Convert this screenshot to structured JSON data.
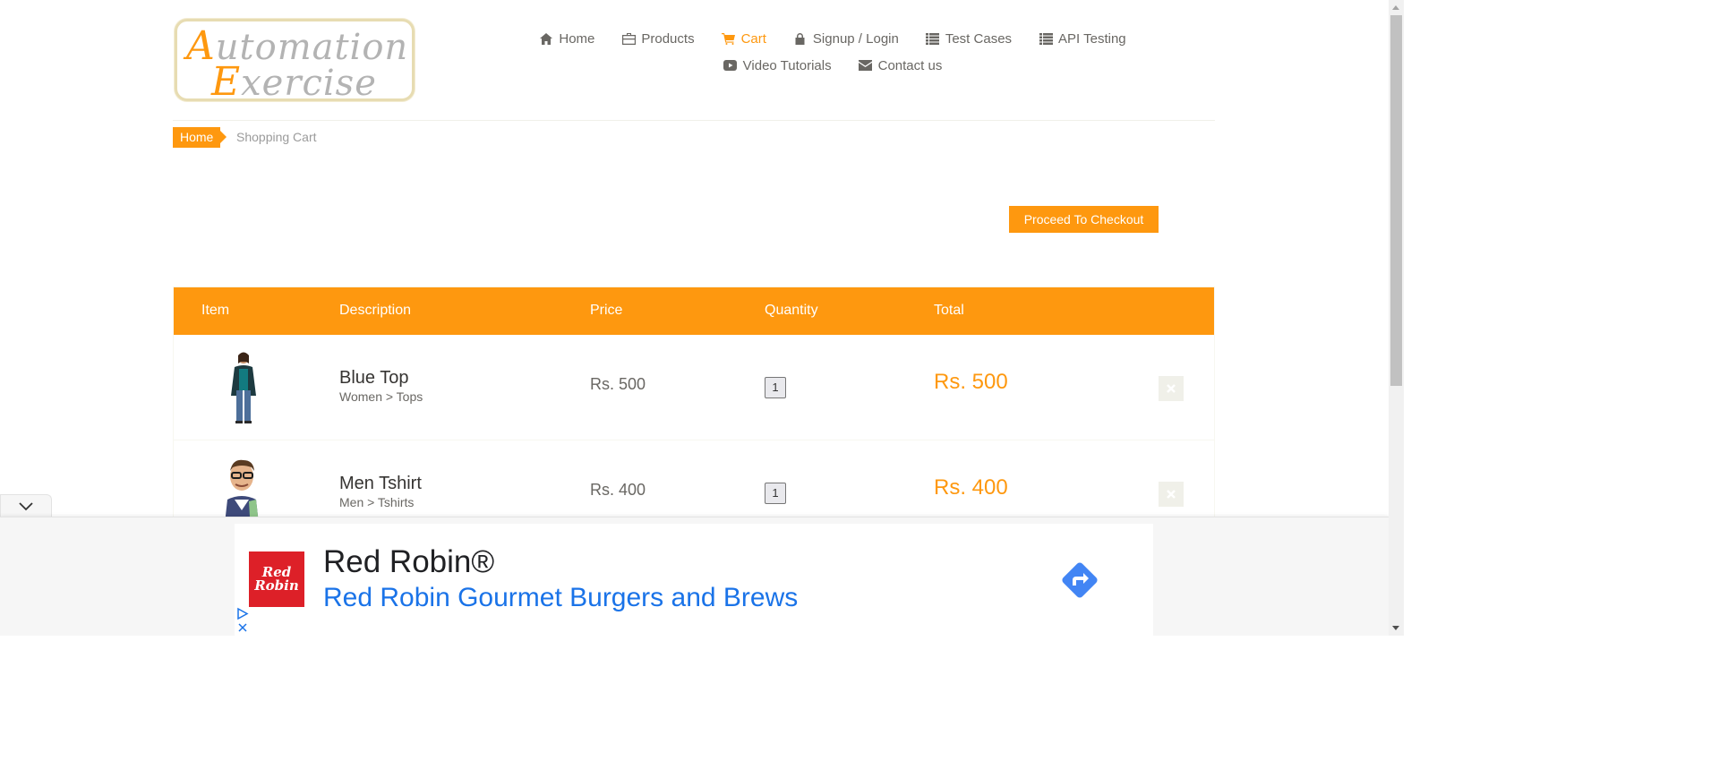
{
  "logo": {
    "line1_cap": "A",
    "line1_rest": "utomation",
    "line2_cap": "E",
    "line2_rest": "xercise"
  },
  "nav": {
    "items": [
      {
        "label": "Home",
        "icon": "home-icon",
        "active": false
      },
      {
        "label": "Products",
        "icon": "products-icon",
        "active": false
      },
      {
        "label": "Cart",
        "icon": "cart-icon",
        "active": true
      },
      {
        "label": "Signup / Login",
        "icon": "lock-icon",
        "active": false
      },
      {
        "label": "Test Cases",
        "icon": "list-icon",
        "active": false
      },
      {
        "label": "API Testing",
        "icon": "list-icon",
        "active": false
      },
      {
        "label": "Video Tutorials",
        "icon": "youtube-icon",
        "active": false
      },
      {
        "label": "Contact us",
        "icon": "envelope-icon",
        "active": false
      }
    ]
  },
  "breadcrumb": {
    "home": "Home",
    "current": "Shopping Cart"
  },
  "checkout_label": "Proceed To Checkout",
  "cart": {
    "headers": {
      "item": "Item",
      "description": "Description",
      "price": "Price",
      "quantity": "Quantity",
      "total": "Total"
    },
    "rows": [
      {
        "name": "Blue Top",
        "category": "Women > Tops",
        "price": "Rs. 500",
        "quantity": "1",
        "total": "Rs. 500"
      },
      {
        "name": "Men Tshirt",
        "category": "Men > Tshirts",
        "price": "Rs. 400",
        "quantity": "1",
        "total": "Rs. 400"
      }
    ]
  },
  "ad": {
    "logo_line1": "Red",
    "logo_line2": "Robin",
    "title": "Red Robin®",
    "subtitle": "Red Robin Gourmet Burgers and Brews"
  },
  "colors": {
    "accent": "#fe980f",
    "ad_link": "#1a73e8",
    "ad_brand": "#dd2028"
  }
}
